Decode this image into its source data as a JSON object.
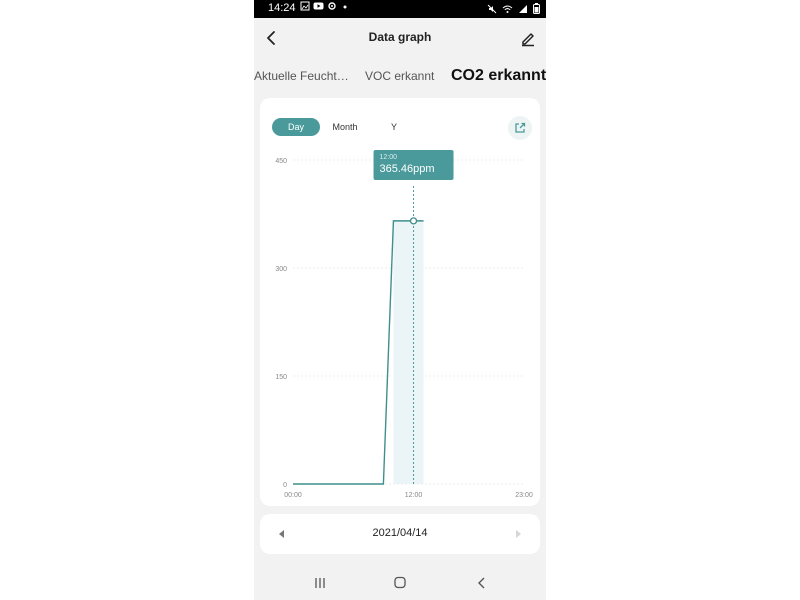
{
  "status_bar": {
    "time": "14:24",
    "left_icons": [
      "image-icon",
      "youtube-icon",
      "settings-icon",
      "dot-icon"
    ],
    "right_icons": [
      "mute-icon",
      "wifi-icon",
      "signal-icon",
      "battery-icon"
    ]
  },
  "header": {
    "title": "Data graph",
    "back_icon": "chevron-left-icon",
    "edit_icon": "pencil-icon"
  },
  "tabs": [
    {
      "label": "Aktuelle Feucht…",
      "active": false
    },
    {
      "label": "VOC erkannt",
      "active": false
    },
    {
      "label": "CO2 erkannt",
      "active": true
    }
  ],
  "range_selector": {
    "options": [
      "Day",
      "Month",
      "Y"
    ],
    "selected": "Day"
  },
  "tooltip": {
    "time": "12:00",
    "value": "365.46ppm"
  },
  "chart_data": {
    "type": "line",
    "x": [
      "00:00",
      "09:00",
      "10:00",
      "12:00",
      "13:00"
    ],
    "series": [
      {
        "values": [
          0,
          0,
          365.46,
          365.46,
          365.46
        ]
      }
    ],
    "y_ticks": [
      "0",
      "150",
      "300",
      "450"
    ],
    "x_ticks": [
      "00:00",
      "12:00",
      "23:00"
    ],
    "ylim": [
      0,
      450
    ],
    "xlim_hours": [
      0,
      23
    ],
    "grid": true,
    "highlight_x": "12:00",
    "colors": {
      "line": "#3f8f8c",
      "fill": "#e9f3f6",
      "accent": "#4a9a9c"
    }
  },
  "date_nav": {
    "date": "2021/04/14"
  },
  "nav_bar": {
    "icons": [
      "recent-apps-icon",
      "home-icon",
      "back-icon"
    ]
  },
  "colors": {
    "accent": "#4a9a9c",
    "background": "#f2f2f2"
  }
}
